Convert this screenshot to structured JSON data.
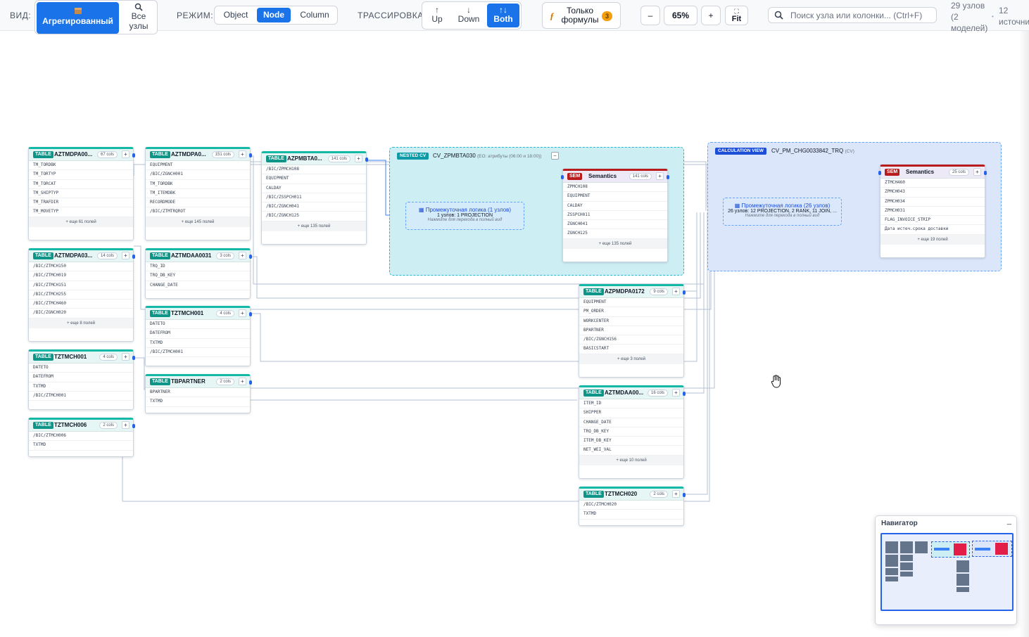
{
  "toolbar": {
    "view_label": "ВИД:",
    "view_aggregated": "Агрегированный",
    "view_all_line1": "Все",
    "view_all_line2": "узлы",
    "mode_label": "РЕЖИМ:",
    "mode_object": "Object",
    "mode_node": "Node",
    "mode_column": "Column",
    "trace_label": "ТРАССИРОВКА:",
    "trace_up": "Up",
    "trace_down": "Down",
    "trace_both": "Both",
    "formula_line1": "Только",
    "formula_line2": "формулы",
    "formula_badge": "3",
    "zoom_minus": "–",
    "zoom_value": "65%",
    "zoom_plus": "+",
    "fit": "Fit",
    "search_placeholder": "Поиск узла или колонки... (Ctrl+F)",
    "stats_line1": "29 узлов",
    "stats_line2": "(2",
    "stats_line3": "моделей)",
    "sources_line1": "12",
    "sources_line2": "источни"
  },
  "nodes": {
    "n1": {
      "tag": "TABLE",
      "title": "AZTMDPA00...",
      "cols": "67 cols",
      "fields": [
        "TM_TORDBK",
        "TM_TORTYP",
        "TM_TORCAT",
        "TM_SHIPTYP",
        "TM_TRAFDIR",
        "TM_MOVETYP"
      ],
      "more": "+ еще 61 полей"
    },
    "n2": {
      "tag": "TABLE",
      "title": "AZTMDPA03...",
      "cols": "14 cols",
      "fields": [
        "/BIC/ZTMCH150",
        "/BIC/ZTMCH019",
        "/BIC/ZTMCH151",
        "/BIC/ZTMCH255",
        "/BIC/ZTMCH460",
        "/BIC/ZGNCH020"
      ],
      "more": "+ еще 8 полей"
    },
    "n3": {
      "tag": "TABLE",
      "title": "TZTMCH001",
      "cols": "4 cols",
      "fields": [
        "DATETO",
        "DATEFROM",
        "TXTMD",
        "/BIC/ZTMCH001"
      ]
    },
    "n4": {
      "tag": "TABLE",
      "title": "TZTMCH006",
      "cols": "2 cols",
      "fields": [
        "/BIC/ZTMCH006",
        "TXTMD"
      ]
    },
    "n5": {
      "tag": "TABLE",
      "title": "AZTMDPA0...",
      "cols": "151 cols",
      "fields": [
        "EQUIPMENT",
        "/BIC/ZGNCH001",
        "TM_TORDBK",
        "TM_ITEMDBK",
        "RECORDMODE",
        "/BIC/ZTMTRQROT"
      ],
      "more": "+ еще 145 полей"
    },
    "n6": {
      "tag": "TABLE",
      "title": "AZTMDAA0031",
      "cols": "3 cols",
      "fields": [
        "TRQ_ID",
        "TRQ_DB_KEY",
        "CHANGE_DATE"
      ]
    },
    "n7": {
      "tag": "TABLE",
      "title": "TZTMCH001",
      "cols": "4 cols",
      "fields": [
        "DATETO",
        "DATEFROM",
        "TXTMD",
        "/BIC/ZTMCH001"
      ]
    },
    "n8": {
      "tag": "TABLE",
      "title": "TBPARTNER",
      "cols": "2 cols",
      "fields": [
        "BPARTNER",
        "TXTMD"
      ]
    },
    "n9": {
      "tag": "TABLE",
      "title": "AZPMBTA0...",
      "cols": "141 cols",
      "fields": [
        "/BIC/ZPMCH108",
        "EQUIPMENT",
        "CALDAY",
        "/BIC/ZSSPCH011",
        "/BIC/ZGNCH041",
        "/BIC/ZGNCH125"
      ],
      "more": "+ еще 135 полей"
    },
    "n10": {
      "tag": "SEM",
      "title": "Semantics",
      "cols": "141 cols",
      "fields": [
        "ZPMCH108",
        "EQUIPMENT",
        "CALDAY",
        "ZSSPCH011",
        "ZGNCH041",
        "ZGNCH125"
      ],
      "more": "+ еще 135 полей"
    },
    "n11": {
      "tag": "TABLE",
      "title": "AZPMDPA0172",
      "cols": "9 cols",
      "fields": [
        "EQUIPMENT",
        "PM_ORDER",
        "WORKCENTER",
        "BPARTNER",
        "/BIC/ZGNCH156",
        "BASICSTART"
      ],
      "more": "+ еще 3 полей"
    },
    "n12": {
      "tag": "TABLE",
      "title": "AZTMDAA00...",
      "cols": "16 cols",
      "fields": [
        "ITEM_ID",
        "SHIPPER",
        "CHANGE_DATE",
        "TRQ_DB_KEY",
        "ITEM_DB_KEY",
        "NET_WEI_VAL"
      ],
      "more": "+ еще 10 полей"
    },
    "n13": {
      "tag": "TABLE",
      "title": "TZTMCH020",
      "cols": "2 cols",
      "fields": [
        "/BIC/ZTMCH020",
        "TXTMD"
      ]
    },
    "n14": {
      "tag": "SEM",
      "title": "Semantics",
      "cols": "25 cols",
      "fields": [
        "ZTMCH460",
        "ZPMCH043",
        "ZPMCH034",
        "ZPMCH031",
        "FLAG_INVOICE_STRIP",
        "Дата истеч.срока доставки"
      ],
      "more": "+ еще 19 полей"
    }
  },
  "nested": {
    "tag": "NESTED CV",
    "title": "CV_ZPMBTA030",
    "subtitle": "(EO: атрибуты (06:00 и 18:00))",
    "collapse": "–",
    "logic_title": "Промежуточная логика (1 узлов)",
    "logic_desc": "1 узлов: 1 PROJECTION",
    "logic_hint": "Нажмите для перехода в полный вид"
  },
  "calc": {
    "tag": "CALCULATION VIEW",
    "title": "CV_PM_CHG0033842_TRQ",
    "subtitle": "(CV)",
    "logic_title": "Промежуточная логика (26 узлов)",
    "logic_desc": "26 узлов: 12 PROJECTION, 2 RANK, 11 JOIN, ...",
    "logic_hint": "Нажмите для перехода в полный вид"
  },
  "navigator": {
    "title": "Навигатор",
    "minimize": "_"
  },
  "colors": {
    "accent": "#1a73e8",
    "table_tag": "#0f9488",
    "sem_tag": "#b91c1c",
    "nested_bg": "#cdeef3",
    "calc_bg": "#dbe6fb"
  }
}
